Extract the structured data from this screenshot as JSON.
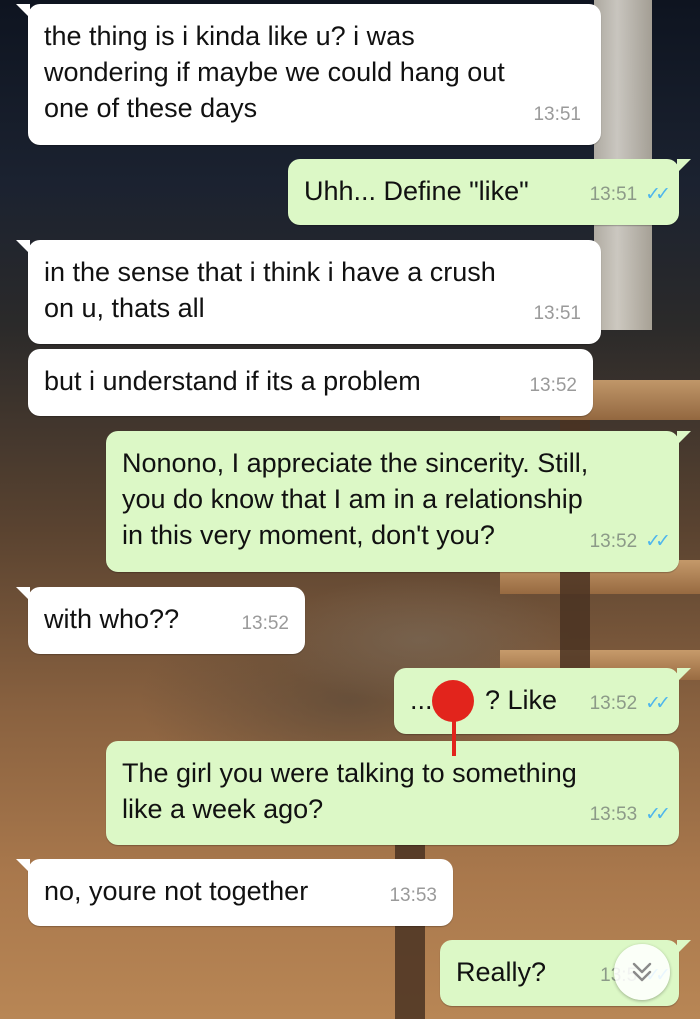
{
  "messages": [
    {
      "dir": "in",
      "lines": [
        "the thing is i kinda like u? i was",
        "wondering if maybe we could hang out",
        "one of these days"
      ],
      "time": "13:51"
    },
    {
      "dir": "out",
      "lines": [
        "Uhh... Define \"like\""
      ],
      "time": "13:51"
    },
    {
      "dir": "in",
      "lines": [
        "in the sense that i think i have a crush",
        "on u, thats all"
      ],
      "time": "13:51"
    },
    {
      "dir": "in",
      "lines": [
        "but i understand if its a problem"
      ],
      "time": "13:52"
    },
    {
      "dir": "out",
      "lines": [
        "Nonono, I appreciate the sincerity. Still,",
        "you do know that I am in a relationship",
        "in this very moment, don't you?"
      ],
      "time": "13:52"
    },
    {
      "dir": "in",
      "lines": [
        "with who??"
      ],
      "time": "13:52"
    },
    {
      "dir": "out",
      "lines": [
        "...       ? Like"
      ],
      "time": "13:52"
    },
    {
      "dir": "out",
      "lines": [
        "The girl you were talking to something",
        "like a week ago?"
      ],
      "time": "13:53"
    },
    {
      "dir": "in",
      "lines": [
        "no, youre not together"
      ],
      "time": "13:53"
    },
    {
      "dir": "out",
      "lines": [
        "Really?"
      ],
      "time": "13:5"
    }
  ],
  "icons": {
    "read_receipt": "double-check-icon",
    "scroll_down": "chevron-double-down-icon"
  },
  "colors": {
    "incoming_bubble": "#ffffff",
    "outgoing_bubble": "#dcf8c6",
    "read_tick": "#4fb6ec",
    "redaction": "#e2241c"
  }
}
